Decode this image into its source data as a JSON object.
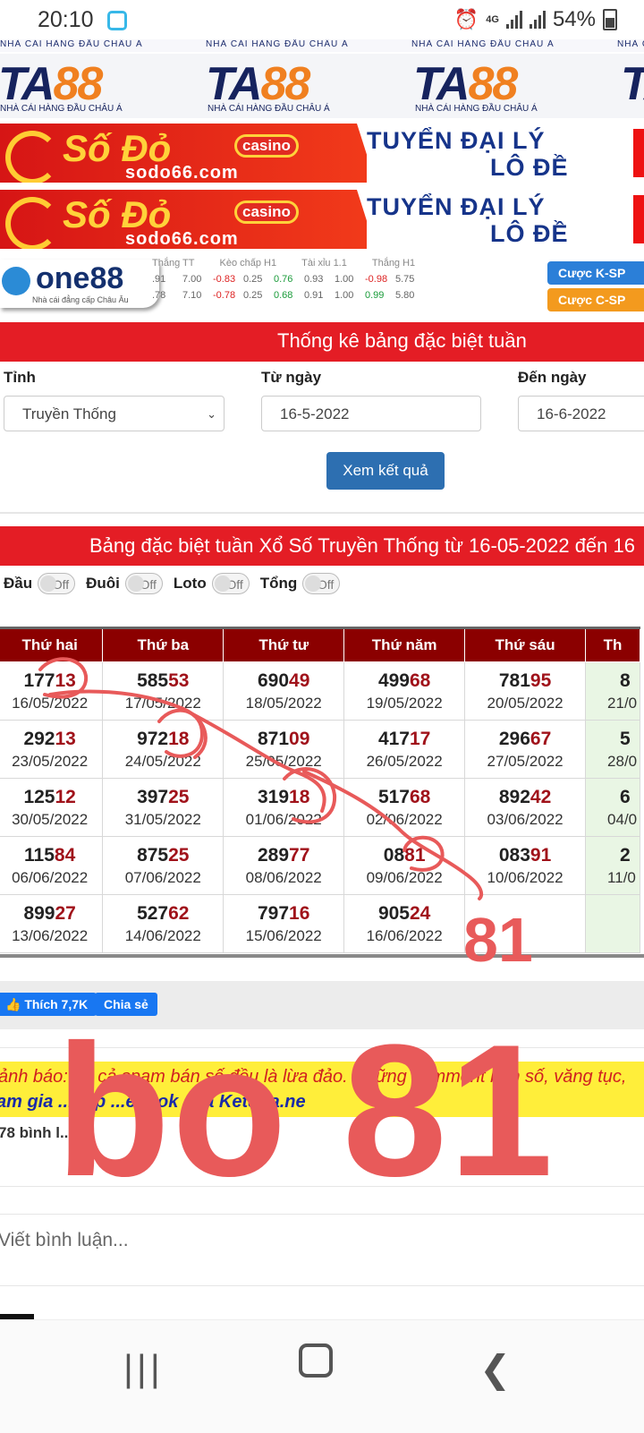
{
  "status_bar": {
    "time": "20:10",
    "network": "4G",
    "battery": "54%"
  },
  "banners": {
    "ta88_logo": "TA88",
    "ta88_tagline": "NHÀ CÁI HÀNG ĐẦU CHÂU Á",
    "sodo_brand": "Số Đỏ",
    "sodo_badge": "casino",
    "sodo_url": "sodo66.com",
    "sodo_line1": "TUYỂN ĐẠI LÝ",
    "sodo_line2": "LÔ ĐỀ",
    "one88_logo": "one88",
    "one88_tagline": "Nhà cái đẳng cấp Châu Âu",
    "odds_headers": [
      "Thắng TT",
      "Kèo chấp H1",
      "Tài xỉu 1.1",
      "Thắng H1"
    ],
    "odds_row1": [
      ".91",
      "7.00",
      "-0.83",
      "0.25",
      "0.76",
      "0.93",
      "1.00",
      "-0.98",
      "5.75"
    ],
    "odds_row2": [
      ".78",
      "7.10",
      "-0.78",
      "0.25",
      "0.68",
      "0.91",
      "1.00",
      "0.99",
      "5.80"
    ],
    "bet_k": "Cược K-SP",
    "bet_c": "Cược C-SP"
  },
  "stats_title": "Thống kê bảng đặc biệt tuần",
  "form": {
    "province_label": "Tỉnh",
    "province_value": "Truyền Thống",
    "from_label": "Từ ngày",
    "from_value": "16-5-2022",
    "to_label": "Đến ngày",
    "to_value": "16-6-2022",
    "submit": "Xem kết quả"
  },
  "table_title": "Bảng đặc biệt tuần Xổ Số Truyền Thống từ 16-05-2022 đến 16",
  "toggles": [
    {
      "label": "Đầu",
      "state": "Off"
    },
    {
      "label": "Đuôi",
      "state": "Off"
    },
    {
      "label": "Loto",
      "state": "Off"
    },
    {
      "label": "Tổng",
      "state": "Off"
    }
  ],
  "columns": [
    "Thứ hai",
    "Thứ ba",
    "Thứ tư",
    "Thứ năm",
    "Thứ sáu",
    "Th"
  ],
  "rows": [
    [
      {
        "p": "177",
        "t": "13",
        "d": "16/05/2022"
      },
      {
        "p": "585",
        "t": "53",
        "d": "17/05/2022"
      },
      {
        "p": "690",
        "t": "49",
        "d": "18/05/2022"
      },
      {
        "p": "499",
        "t": "68",
        "d": "19/05/2022"
      },
      {
        "p": "781",
        "t": "95",
        "d": "20/05/2022"
      },
      {
        "p": "8",
        "t": "",
        "d": "21/0"
      }
    ],
    [
      {
        "p": "292",
        "t": "13",
        "d": "23/05/2022"
      },
      {
        "p": "972",
        "t": "18",
        "d": "24/05/2022"
      },
      {
        "p": "871",
        "t": "09",
        "d": "25/05/2022"
      },
      {
        "p": "417",
        "t": "17",
        "d": "26/05/2022"
      },
      {
        "p": "296",
        "t": "67",
        "d": "27/05/2022"
      },
      {
        "p": "5",
        "t": "",
        "d": "28/0"
      }
    ],
    [
      {
        "p": "125",
        "t": "12",
        "d": "30/05/2022"
      },
      {
        "p": "397",
        "t": "25",
        "d": "31/05/2022"
      },
      {
        "p": "319",
        "t": "18",
        "d": "01/06/2022"
      },
      {
        "p": "517",
        "t": "68",
        "d": "02/06/2022"
      },
      {
        "p": "892",
        "t": "42",
        "d": "03/06/2022"
      },
      {
        "p": "6",
        "t": "",
        "d": "04/0"
      }
    ],
    [
      {
        "p": "115",
        "t": "84",
        "d": "06/06/2022"
      },
      {
        "p": "875",
        "t": "25",
        "d": "07/06/2022"
      },
      {
        "p": "289",
        "t": "77",
        "d": "08/06/2022"
      },
      {
        "p": "08",
        "t": "81",
        "d": "09/06/2022"
      },
      {
        "p": "083",
        "t": "91",
        "d": "10/06/2022"
      },
      {
        "p": "2",
        "t": "",
        "d": "11/0"
      }
    ],
    [
      {
        "p": "899",
        "t": "27",
        "d": "13/06/2022"
      },
      {
        "p": "527",
        "t": "62",
        "d": "14/06/2022"
      },
      {
        "p": "797",
        "t": "16",
        "d": "15/06/2022"
      },
      {
        "p": "905",
        "t": "24",
        "d": "16/06/2022"
      },
      {
        "p": "",
        "t": "",
        "d": ""
      },
      {
        "p": "",
        "t": "",
        "d": ""
      }
    ]
  ],
  "social": {
    "like": "Thích 7,7K",
    "share": "Chia sẻ"
  },
  "warning": {
    "line1": "ảnh báo: ...t cả spam bán số đều là lừa đảo. Những comment bán số, văng tục,",
    "line2": "am gia ...oup ...ebook của Ketqua.ne"
  },
  "comment_count": "78 bình l...",
  "comment_placeholder": "Viết bình luận...",
  "annotations": {
    "small": "81",
    "big": "bo 81",
    "color": "#e85a5a"
  },
  "colors": {
    "red_bar": "#e41d25",
    "header_dark": "#8b0000",
    "number_tail": "#a0121a",
    "button": "#2d6fb1"
  }
}
